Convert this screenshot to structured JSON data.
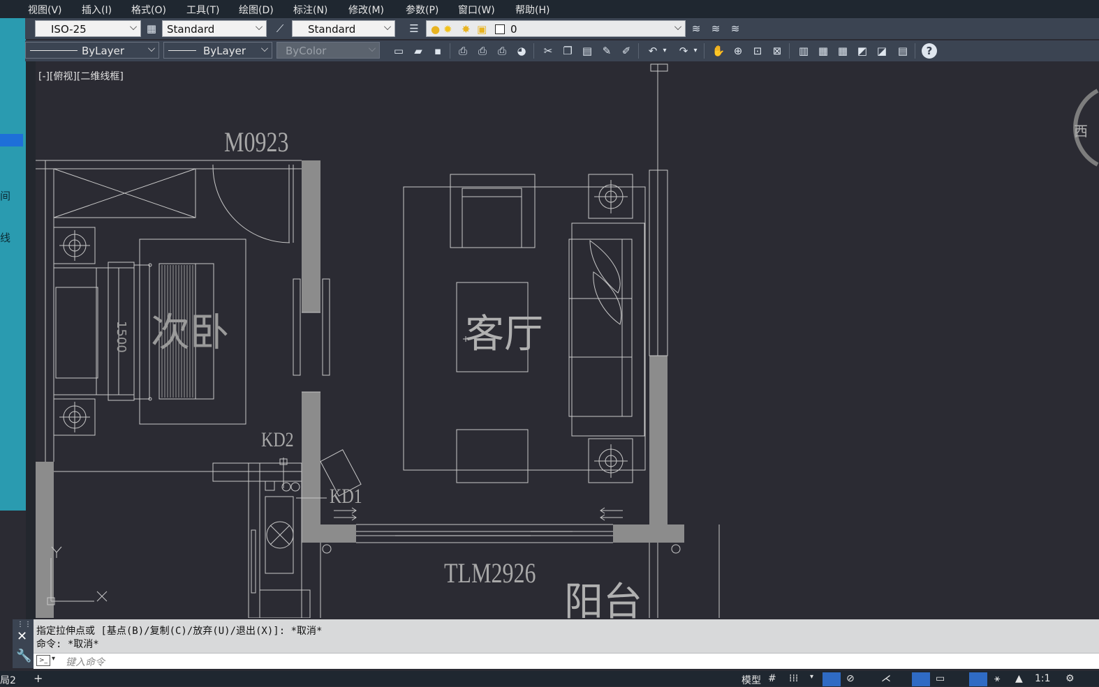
{
  "menu": [
    "视图(V)",
    "插入(I)",
    "格式(O)",
    "工具(T)",
    "绘图(D)",
    "标注(N)",
    "修改(M)",
    "参数(P)",
    "窗口(W)",
    "帮助(H)"
  ],
  "toolbar1": {
    "dim_style": "ISO-25",
    "text_style": "Standard",
    "table_style": "Standard",
    "layer": "0"
  },
  "toolbar2": {
    "linetype": "ByLayer",
    "lineweight": "ByLayer",
    "color": "ByColor"
  },
  "viewport_label": "[-][俯视][二维线框]",
  "drawing": {
    "labels": {
      "door_m0923": "M0923",
      "bedroom": "次卧",
      "bed_size": "1500",
      "living_room": "客厅",
      "kd2": "KD2",
      "kd1": "KD1",
      "tlm2926": "TLM2926",
      "balcony": "阳台"
    },
    "ucs": {
      "x": "X",
      "y": "Y"
    },
    "viewcube_west": "西"
  },
  "left_panel": {
    "chars": [
      "间",
      "线"
    ]
  },
  "command": {
    "history": [
      "指定拉伸点或 [基点(B)/复制(C)/放弃(U)/退出(X)]: *取消*",
      "命令: *取消*"
    ],
    "placeholder": "键入命令"
  },
  "status": {
    "layout_tab": "局2",
    "model": "模型",
    "scale": "1:1"
  },
  "colors": {
    "canvas": "#2b2b33",
    "wall": "#8c8c8c",
    "line": "#c9c9c9",
    "menubar": "#1f2730",
    "toolbar": "#3b4452",
    "left_panel": "#2a9bb0"
  }
}
